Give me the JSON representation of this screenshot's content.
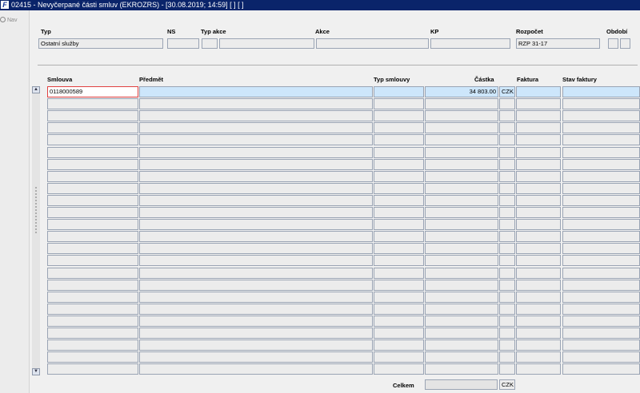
{
  "window": {
    "title": "02415 - Nevyčerpané části smluv (EKROZRS) - [30.08.2019; 14:59]  [ ]  [ ]",
    "app_icon": "F"
  },
  "nav": {
    "label": "Nav"
  },
  "header": {
    "typ": {
      "label": "Typ",
      "value": "Ostatní služby"
    },
    "ns": {
      "label": "NS",
      "value": ""
    },
    "typ_akce": {
      "label": "Typ akce",
      "value": ""
    },
    "akce": {
      "label": "Akce",
      "value": ""
    },
    "kp": {
      "label": "KP",
      "value": ""
    },
    "rozpocet": {
      "label": "Rozpočet",
      "value": "RZP 31-17"
    },
    "obdobi": {
      "label": "Období",
      "value": ""
    }
  },
  "grid": {
    "columns": [
      "Smlouva",
      "Předmět",
      "Typ smlouvy",
      "Částka",
      "Faktura",
      "Stav faktury"
    ],
    "rows": [
      {
        "smlouva": "0118000589",
        "predmet": "",
        "typ": "",
        "castka": "34 803.00",
        "mena": "CZK",
        "faktura": "",
        "stav": ""
      }
    ],
    "empty_rows": 23
  },
  "footer": {
    "celkem_label": "Celkem",
    "celkem_value": "",
    "currency": "CZK"
  }
}
